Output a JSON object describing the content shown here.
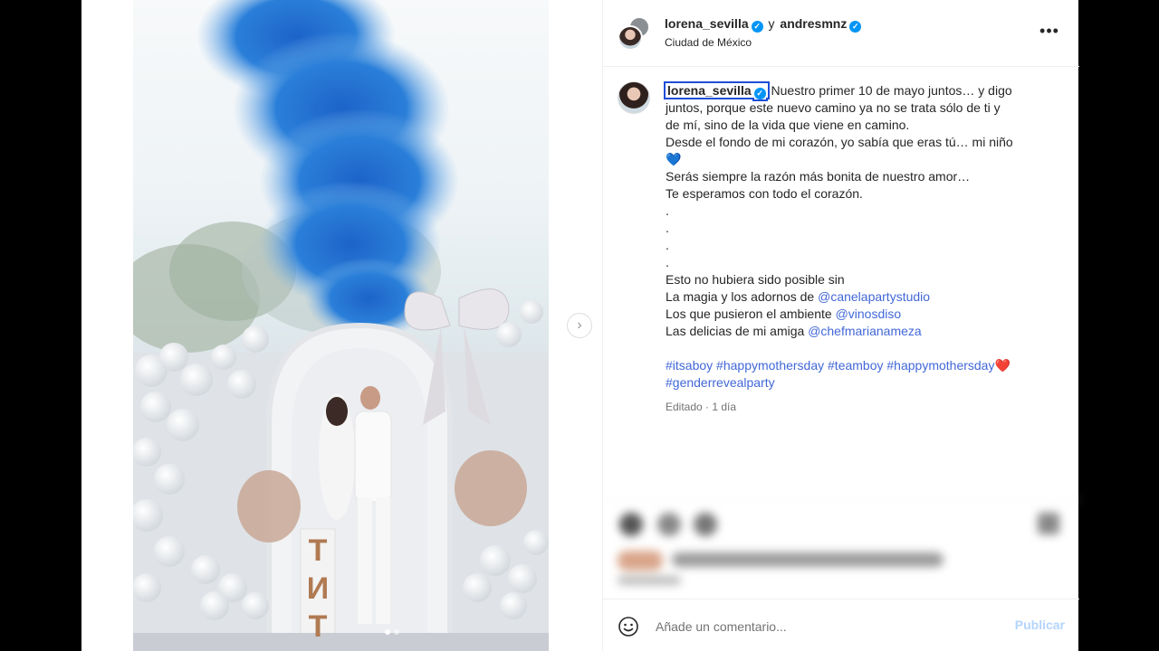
{
  "post": {
    "author1": "lorena_sevilla",
    "connector": "y",
    "author2": "andresmnz",
    "location": "Ciudad de México",
    "more_label": "•••",
    "next_label": "›"
  },
  "caption": {
    "username": "lorena_sevilla",
    "lines": [
      "Nuestro primer 10 de mayo juntos… y digo",
      "juntos, porque este nuevo camino ya no se trata sólo de ti y",
      "de mí, sino de la vida que viene en camino.",
      "Desde el fondo de mi corazón, yo sabía que eras tú… mi niño",
      "Serás siempre la razón más bonita de nuestro amor…",
      "Te esperamos con todo el corazón.",
      ".",
      ".",
      ".",
      ".",
      "Esto no hubiera sido posible sin",
      "La magia y los adornos de",
      "Los que pusieron el ambiente",
      "Las delicias de mi amiga"
    ],
    "blue_heart": "💙",
    "mentions": [
      "@canelapartystudio",
      "@vinosdiso",
      "@chefmarianameza"
    ],
    "hashtags": [
      "#itsaboy",
      "#happymothersday",
      "#teamboy",
      "#happymothersday",
      "#genderrevealparty"
    ],
    "red_heart": "❤️",
    "meta": "Editado · 1 día"
  },
  "photo_sign": [
    "T",
    "И",
    "T"
  ],
  "comment": {
    "placeholder": "Añade un comentario...",
    "publish_label": "Publicar"
  },
  "colors": {
    "verified": "#0095f6",
    "link": "#4267d8",
    "publish_disabled": "#b3d4fc",
    "smoke": "#1f6fd1"
  },
  "carousel": {
    "total": 2,
    "current": 1
  }
}
